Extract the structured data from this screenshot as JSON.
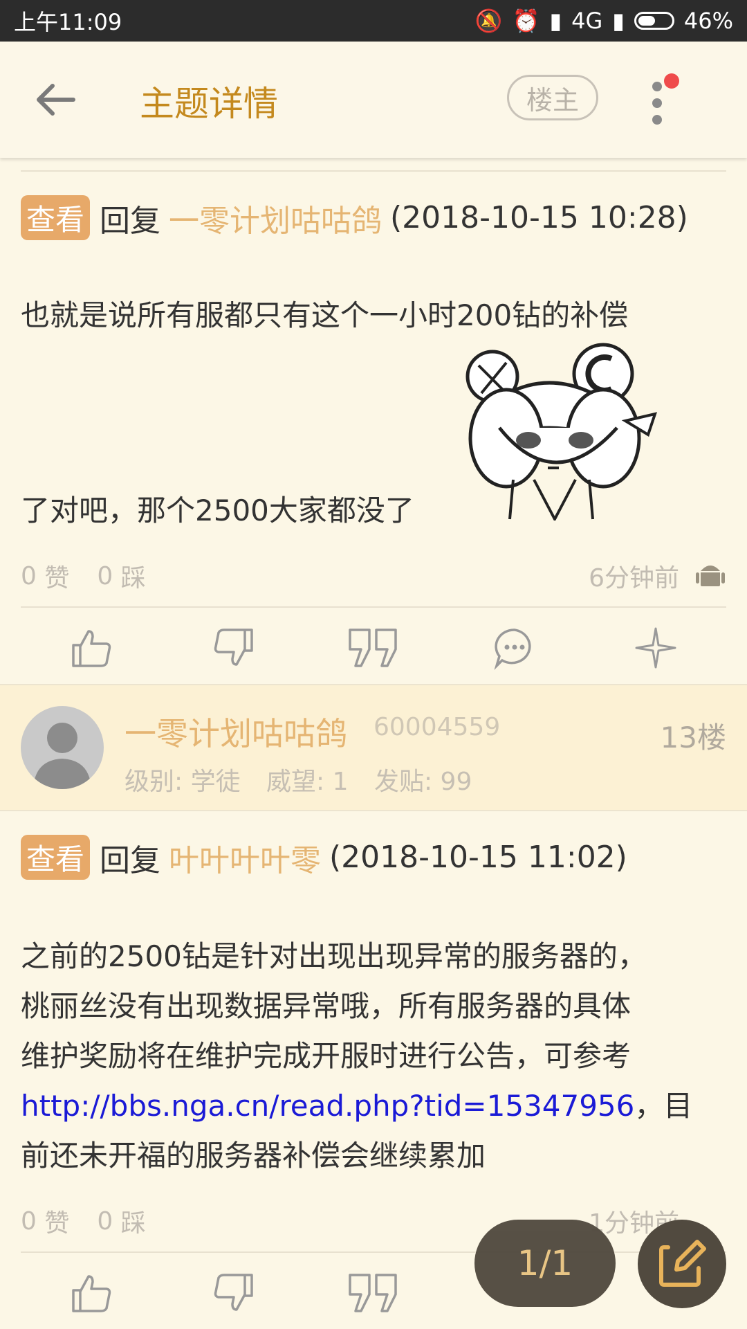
{
  "status_bar": {
    "time": "上午11:09",
    "network": "4G",
    "battery": "46%",
    "battery_level": 0.46
  },
  "header": {
    "title": "主题详情",
    "op_button": "楼主"
  },
  "posts": [
    {
      "chip": "查看",
      "reply_prefix": "回复",
      "reply_user": "一零计划咕咕鸽",
      "reply_time": "(2018-10-15 10:28)",
      "text_line1": "也就是说所有服都只有这个一小时200钻的补偿",
      "text_line2": "了对吧，那个2500大家都没了",
      "likes": "0",
      "like_label": "赞",
      "dislikes": "0",
      "dislike_label": "踩",
      "time_ago": "6分钟前"
    },
    {
      "user": {
        "name": "一零计划咕咕鸽",
        "id": "60004559",
        "floor": "13楼",
        "level": "级别: 学徒",
        "prestige": "威望: 1",
        "posts": "发贴: 99"
      },
      "chip": "查看",
      "reply_prefix": "回复",
      "reply_user": "叶叶叶叶零",
      "reply_time": "(2018-10-15 11:02)",
      "lines": [
        "之前的2500钻是针对出现出现异常的服务器的，",
        "桃丽丝没有出现数据异常哦，所有服务器的具体",
        "维护奖励将在维护完成开服时进行公告，可参考"
      ],
      "link": "http://bbs.nga.cn/read.php?tid=15347956",
      "after_link": "，目",
      "last_line": "前还未开福的服务器补偿会继续累加",
      "likes": "0",
      "like_label": "赞",
      "dislikes": "0",
      "dislike_label": "踩",
      "time_ago": "1分钟前"
    }
  ],
  "pager": "1/1"
}
